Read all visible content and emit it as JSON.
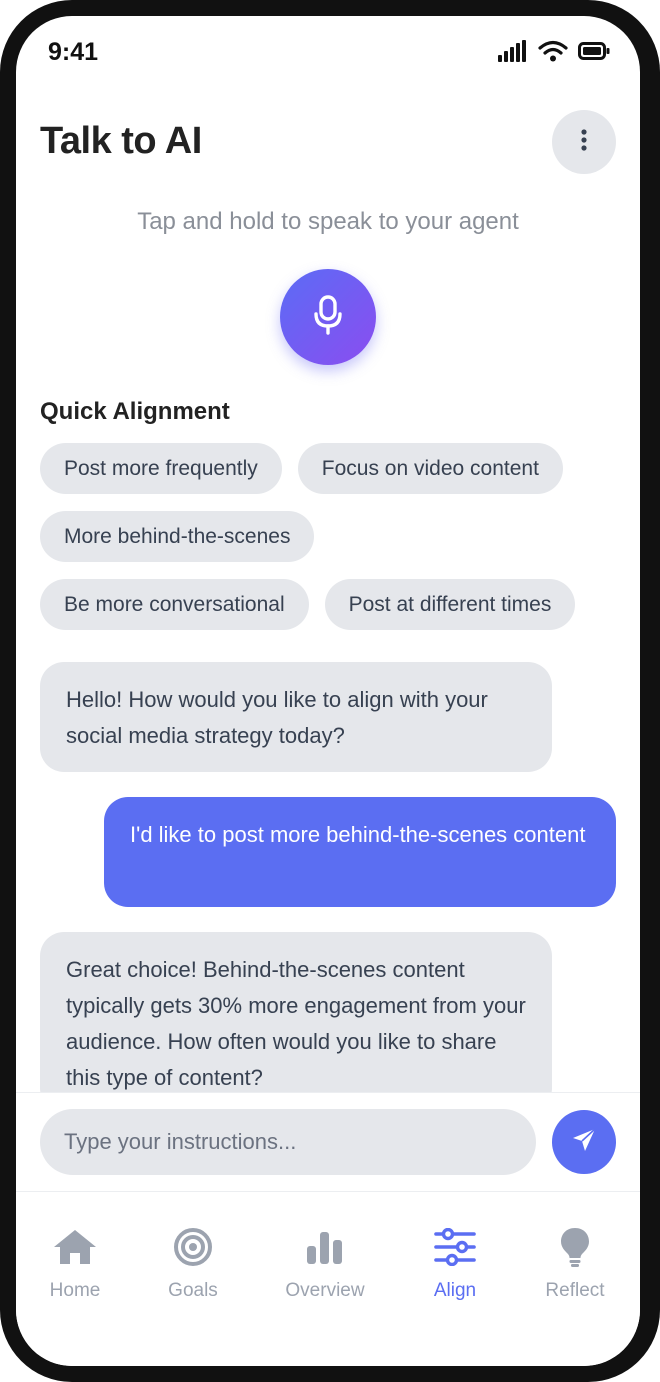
{
  "status_bar": {
    "time": "9:41"
  },
  "header": {
    "title": "Talk to AI",
    "more_icon": "vertical-dots-icon"
  },
  "voice": {
    "hint": "Tap and hold to speak to your agent",
    "mic_icon": "microphone-icon"
  },
  "quick_alignment": {
    "title": "Quick Alignment",
    "chips": [
      "Post more frequently",
      "Focus on video content",
      "More behind-the-scenes",
      "Be more conversational",
      "Post at different times"
    ]
  },
  "chat": {
    "messages": [
      {
        "sender": "ai",
        "text": "Hello! How would you like to align with your social media strategy today?"
      },
      {
        "sender": "user",
        "text": "I'd like to post more behind-the-scenes content"
      },
      {
        "sender": "ai",
        "text": "Great choice! Behind-the-scenes content typically gets 30% more engagement from your audience. How often would you like to share this type of content?"
      }
    ]
  },
  "composer": {
    "placeholder": "Type your instructions...",
    "send_icon": "send-icon"
  },
  "tabs": [
    {
      "label": "Home",
      "icon": "home-icon",
      "active": false
    },
    {
      "label": "Goals",
      "icon": "target-icon",
      "active": false
    },
    {
      "label": "Overview",
      "icon": "bar-chart-icon",
      "active": false
    },
    {
      "label": "Align",
      "icon": "sliders-icon",
      "active": true
    },
    {
      "label": "Reflect",
      "icon": "lightbulb-icon",
      "active": false
    }
  ],
  "colors": {
    "accent": "#5b6ef2",
    "chip_bg": "#e5e7eb",
    "inactive": "#9ca3af"
  }
}
